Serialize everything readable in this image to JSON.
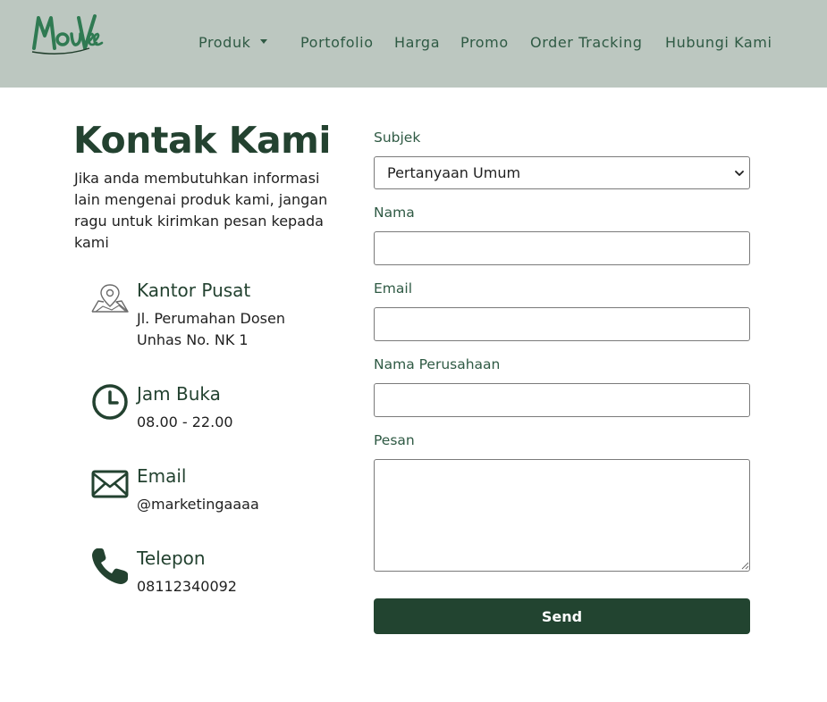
{
  "brand": {
    "name": "MouVee"
  },
  "navbar": {
    "items": [
      {
        "label": "Produk",
        "dropdown": true
      },
      {
        "label": "Portofolio"
      },
      {
        "label": "Harga"
      },
      {
        "label": "Promo"
      },
      {
        "label": "Order Tracking"
      },
      {
        "label": "Hubungi Kami"
      }
    ]
  },
  "contact": {
    "title": "Kontak Kami",
    "intro": "Jika anda membutuhkan informasi lain mengenai produk kami, jangan ragu untuk kirimkan pesan kepada kami",
    "info": [
      {
        "icon": "map-pin-icon",
        "title": "Kantor Pusat",
        "text": "Jl. Perumahan Dosen Unhas No. NK 1"
      },
      {
        "icon": "clock-icon",
        "title": "Jam Buka",
        "text": "08.00 - 22.00"
      },
      {
        "icon": "envelope-icon",
        "title": "Email",
        "text": "@marketingaaaa"
      },
      {
        "icon": "phone-icon",
        "title": "Telepon",
        "text": "08112340092"
      }
    ]
  },
  "form": {
    "subject_label": "Subjek",
    "subject_value": "Pertanyaan Umum",
    "name_label": "Nama",
    "name_value": "",
    "email_label": "Email",
    "email_value": "",
    "company_label": "Nama Perusahaan",
    "company_value": "",
    "message_label": "Pesan",
    "message_value": "",
    "send_label": "Send"
  },
  "colors": {
    "navbar_bg": "#bcc7c0",
    "accent": "#224430",
    "nav_text": "#2f5a44"
  }
}
